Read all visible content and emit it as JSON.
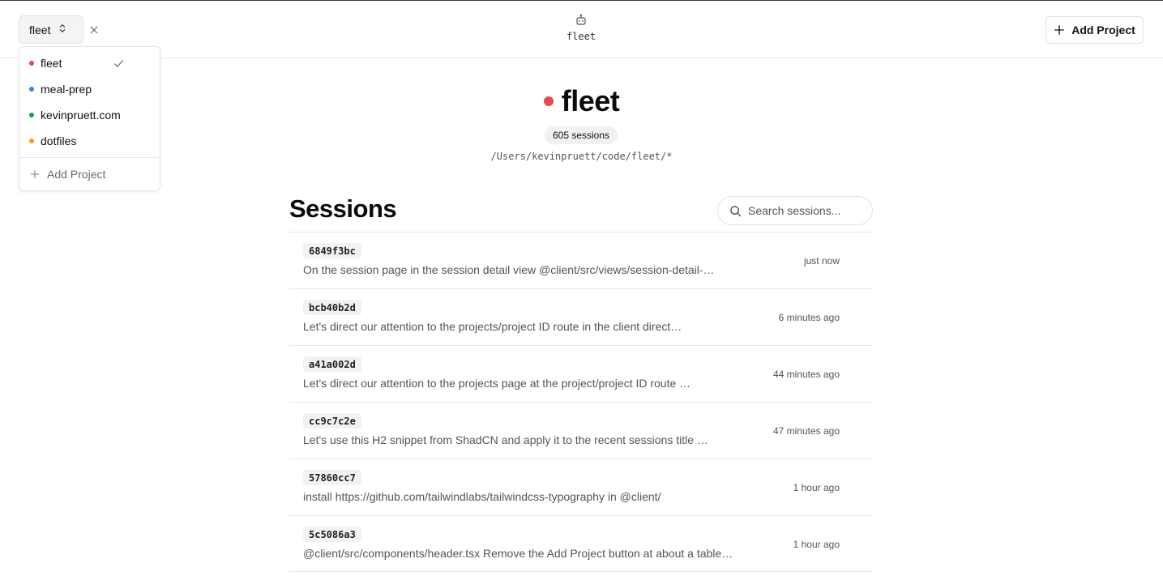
{
  "header": {
    "selected_project": "fleet",
    "center_name": "fleet",
    "add_project_label": "Add Project"
  },
  "dropdown": {
    "items": [
      {
        "label": "fleet",
        "color": "#e5484d",
        "selected": true
      },
      {
        "label": "meal-prep",
        "color": "#3b82f6",
        "selected": false
      },
      {
        "label": "kevinpruett.com",
        "color": "#16a34a",
        "selected": false
      },
      {
        "label": "dotfiles",
        "color": "#f59e0b",
        "selected": false
      }
    ],
    "add_label": "Add Project"
  },
  "project": {
    "name": "fleet",
    "color": "#e5484d",
    "session_count": "605 sessions",
    "path": "/Users/kevinpruett/code/fleet/*"
  },
  "sessions": {
    "heading": "Sessions",
    "search_placeholder": "Search sessions...",
    "rows": [
      {
        "id": "6849f3bc",
        "description": "On the session page in the session detail view @client/src/views/session-detail-…",
        "time": "just now"
      },
      {
        "id": "bcb40b2d",
        "description": "Let's direct our attention to the projects/project ID route in the client direct…",
        "time": "6 minutes ago"
      },
      {
        "id": "a41a002d",
        "description": "Let's direct our attention to the projects page at the project/project ID route …",
        "time": "44 minutes ago"
      },
      {
        "id": "cc9c7c2e",
        "description": "Let's use this H2 snippet from ShadCN and apply it to the recent sessions title …",
        "time": "47 minutes ago"
      },
      {
        "id": "57860cc7",
        "description": "install https://github.com/tailwindlabs/tailwindcss-typography in @client/",
        "time": "1 hour ago"
      },
      {
        "id": "5c5086a3",
        "description": "@client/src/components/header.tsx Remove the Add Project button at about a table…",
        "time": "1 hour ago"
      }
    ]
  }
}
